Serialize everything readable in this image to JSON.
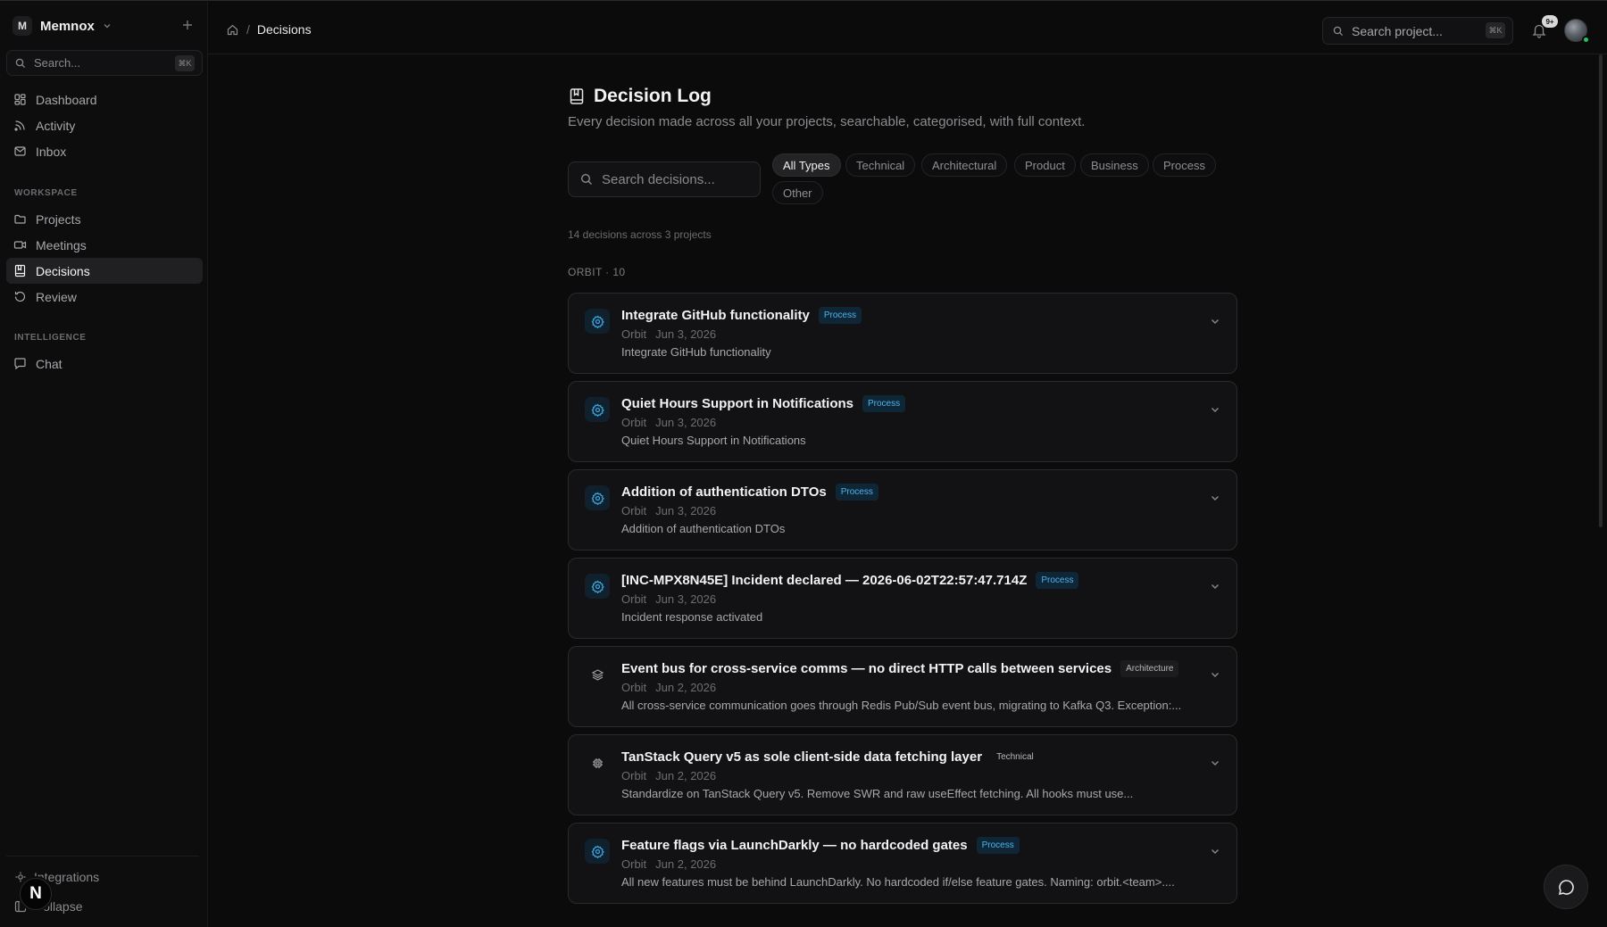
{
  "workspace": {
    "initial": "M",
    "name": "Memnox"
  },
  "sidebar": {
    "search_placeholder": "Search...",
    "search_kbd": "⌘K",
    "top_items": [
      {
        "label": "Dashboard",
        "icon": "dashboard-icon"
      },
      {
        "label": "Activity",
        "icon": "activity-icon"
      },
      {
        "label": "Inbox",
        "icon": "inbox-icon"
      }
    ],
    "workspace_section": "WORKSPACE",
    "workspace_items": [
      {
        "label": "Projects",
        "icon": "folder-icon"
      },
      {
        "label": "Meetings",
        "icon": "video-icon"
      },
      {
        "label": "Decisions",
        "icon": "decision-book-icon",
        "active": true
      },
      {
        "label": "Review",
        "icon": "review-icon"
      }
    ],
    "intelligence_section": "INTELLIGENCE",
    "intelligence_items": [
      {
        "label": "Chat",
        "icon": "chat-icon"
      }
    ],
    "bottom_items": [
      {
        "label": "Integrations",
        "icon": "integrations-icon"
      },
      {
        "label": "Collapse",
        "icon": "collapse-icon"
      }
    ],
    "n_badge": "N"
  },
  "topbar": {
    "breadcrumb_current": "Decisions",
    "breadcrumb_sep": "/",
    "search_placeholder": "Search project...",
    "search_kbd": "⌘K",
    "notif_count": "9+"
  },
  "page": {
    "title": "Decision Log",
    "subtitle": "Every decision made across all your projects, searchable, categorised, with full context.",
    "search_placeholder": "Search decisions...",
    "filters": [
      "All Types",
      "Technical",
      "Architectural",
      "Product",
      "Business",
      "Process",
      "Other"
    ],
    "active_filter": "All Types",
    "count_line": "14 decisions across 3 projects",
    "group_label": "ORBIT · 10"
  },
  "decisions": [
    {
      "title": "Integrate GitHub functionality",
      "tag": "Process",
      "project": "Orbit",
      "date": "Jun 3, 2026",
      "desc": "Integrate GitHub functionality",
      "icon": "gear-icon"
    },
    {
      "title": "Quiet Hours Support in Notifications",
      "tag": "Process",
      "project": "Orbit",
      "date": "Jun 3, 2026",
      "desc": "Quiet Hours Support in Notifications",
      "icon": "gear-icon"
    },
    {
      "title": "Addition of authentication DTOs",
      "tag": "Process",
      "project": "Orbit",
      "date": "Jun 3, 2026",
      "desc": "Addition of authentication DTOs",
      "icon": "gear-icon"
    },
    {
      "title": "[INC-MPX8N45E] Incident declared — 2026-06-02T22:57:47.714Z",
      "tag": "Process",
      "project": "Orbit",
      "date": "Jun 3, 2026",
      "desc": "Incident response activated",
      "icon": "gear-icon"
    },
    {
      "title": "Event bus for cross-service comms — no direct HTTP calls between services",
      "tag": "Architecture",
      "project": "Orbit",
      "date": "Jun 2, 2026",
      "desc": "All cross-service communication goes through Redis Pub/Sub event bus, migrating to Kafka Q3. Exception:...",
      "icon": "layers-icon"
    },
    {
      "title": "TanStack Query v5 as sole client-side data fetching layer",
      "tag": "Technical",
      "project": "Orbit",
      "date": "Jun 2, 2026",
      "desc": "Standardize on TanStack Query v5. Remove SWR and raw useEffect fetching. All hooks must use...",
      "icon": "cpu-icon"
    },
    {
      "title": "Feature flags via LaunchDarkly — no hardcoded gates",
      "tag": "Process",
      "project": "Orbit",
      "date": "Jun 2, 2026",
      "desc": "All new features must be behind LaunchDarkly. No hardcoded if/else feature gates. Naming: orbit.<team>....",
      "icon": "gear-icon"
    }
  ]
}
